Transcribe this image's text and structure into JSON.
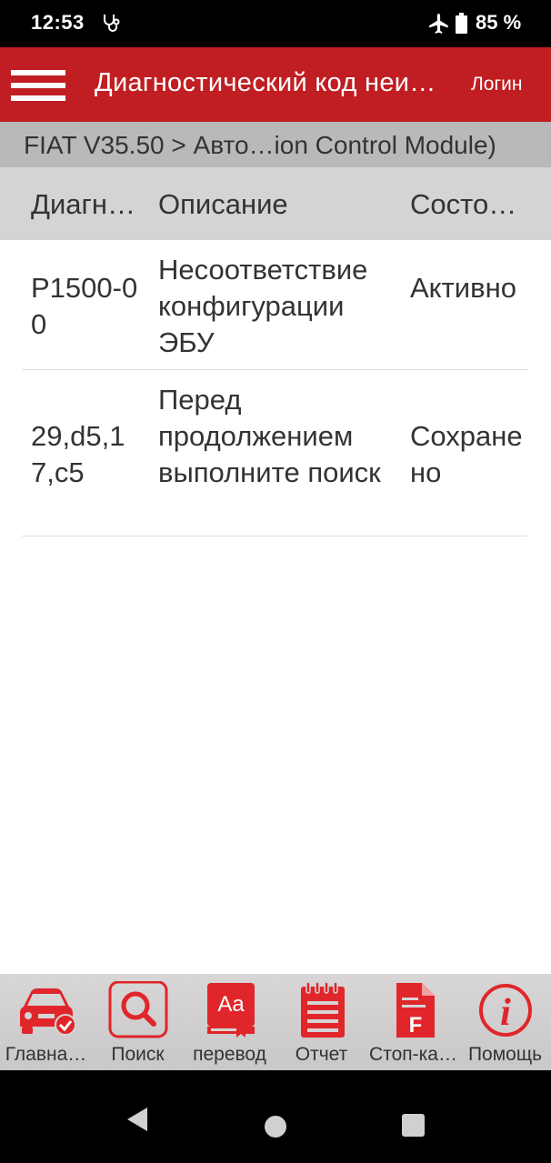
{
  "status": {
    "time": "12:53",
    "battery": "85 %"
  },
  "app_bar": {
    "title": "Диагностический код неи…",
    "login": "Логин"
  },
  "breadcrumb": "FIAT V35.50 > Авто…ion Control Module)",
  "table": {
    "headers": [
      "Диагн…",
      "Описание",
      "Состо…"
    ],
    "rows": [
      {
        "code": "P1500-00",
        "description": "Несоответствие конфигурации ЭБУ",
        "state": "Активно"
      },
      {
        "code": "29,d5,17,c5",
        "description": "Перед продолжением выполните поиск",
        "state": "Сохранено"
      }
    ]
  },
  "toolbar": [
    {
      "label": "Главна…",
      "icon": "car-check-icon"
    },
    {
      "label": "Поиск",
      "icon": "search-icon"
    },
    {
      "label": "перевод",
      "icon": "translate-book-icon"
    },
    {
      "label": "Отчет",
      "icon": "report-notebook-icon"
    },
    {
      "label": "Стоп-ка…",
      "icon": "freeze-frame-document-icon"
    },
    {
      "label": "Помощь",
      "icon": "info-icon"
    }
  ],
  "colors": {
    "accent": "#c01e22",
    "header_bg": "#d6d3d3",
    "breadcrumb_bg": "#b9b9b9",
    "icon_red": "#e0262a"
  }
}
